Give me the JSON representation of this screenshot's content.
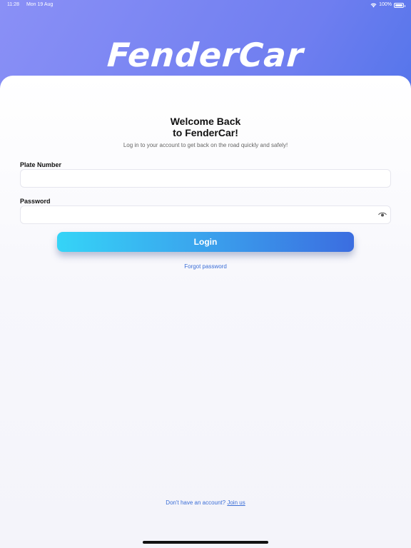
{
  "status_bar": {
    "time": "11:28",
    "date": "Mon 19 Aug",
    "battery": "100%",
    "icons": [
      "wifi-icon",
      "battery-icon"
    ]
  },
  "brand": {
    "logo_text": "FenderCar"
  },
  "login": {
    "title_line1": "Welcome Back",
    "title_line2": "to FenderCar!",
    "subtitle": "Log in to your account to get back on the road quickly and safely!",
    "plate_label": "Plate Number",
    "plate_value": "",
    "password_label": "Password",
    "password_value": "",
    "password_toggle_icon": "eye-icon",
    "login_button": "Login",
    "forgot_password": "Forgot password",
    "no_account_text": "Don't have an account?",
    "join_link": "Join us"
  },
  "colors": {
    "accent_link": "#3b6ed6",
    "button_gradient_start": "#35d4f7",
    "button_gradient_end": "#3b6de0",
    "header_gradient_start": "#8a90f6",
    "header_gradient_end": "#2a63e4"
  }
}
